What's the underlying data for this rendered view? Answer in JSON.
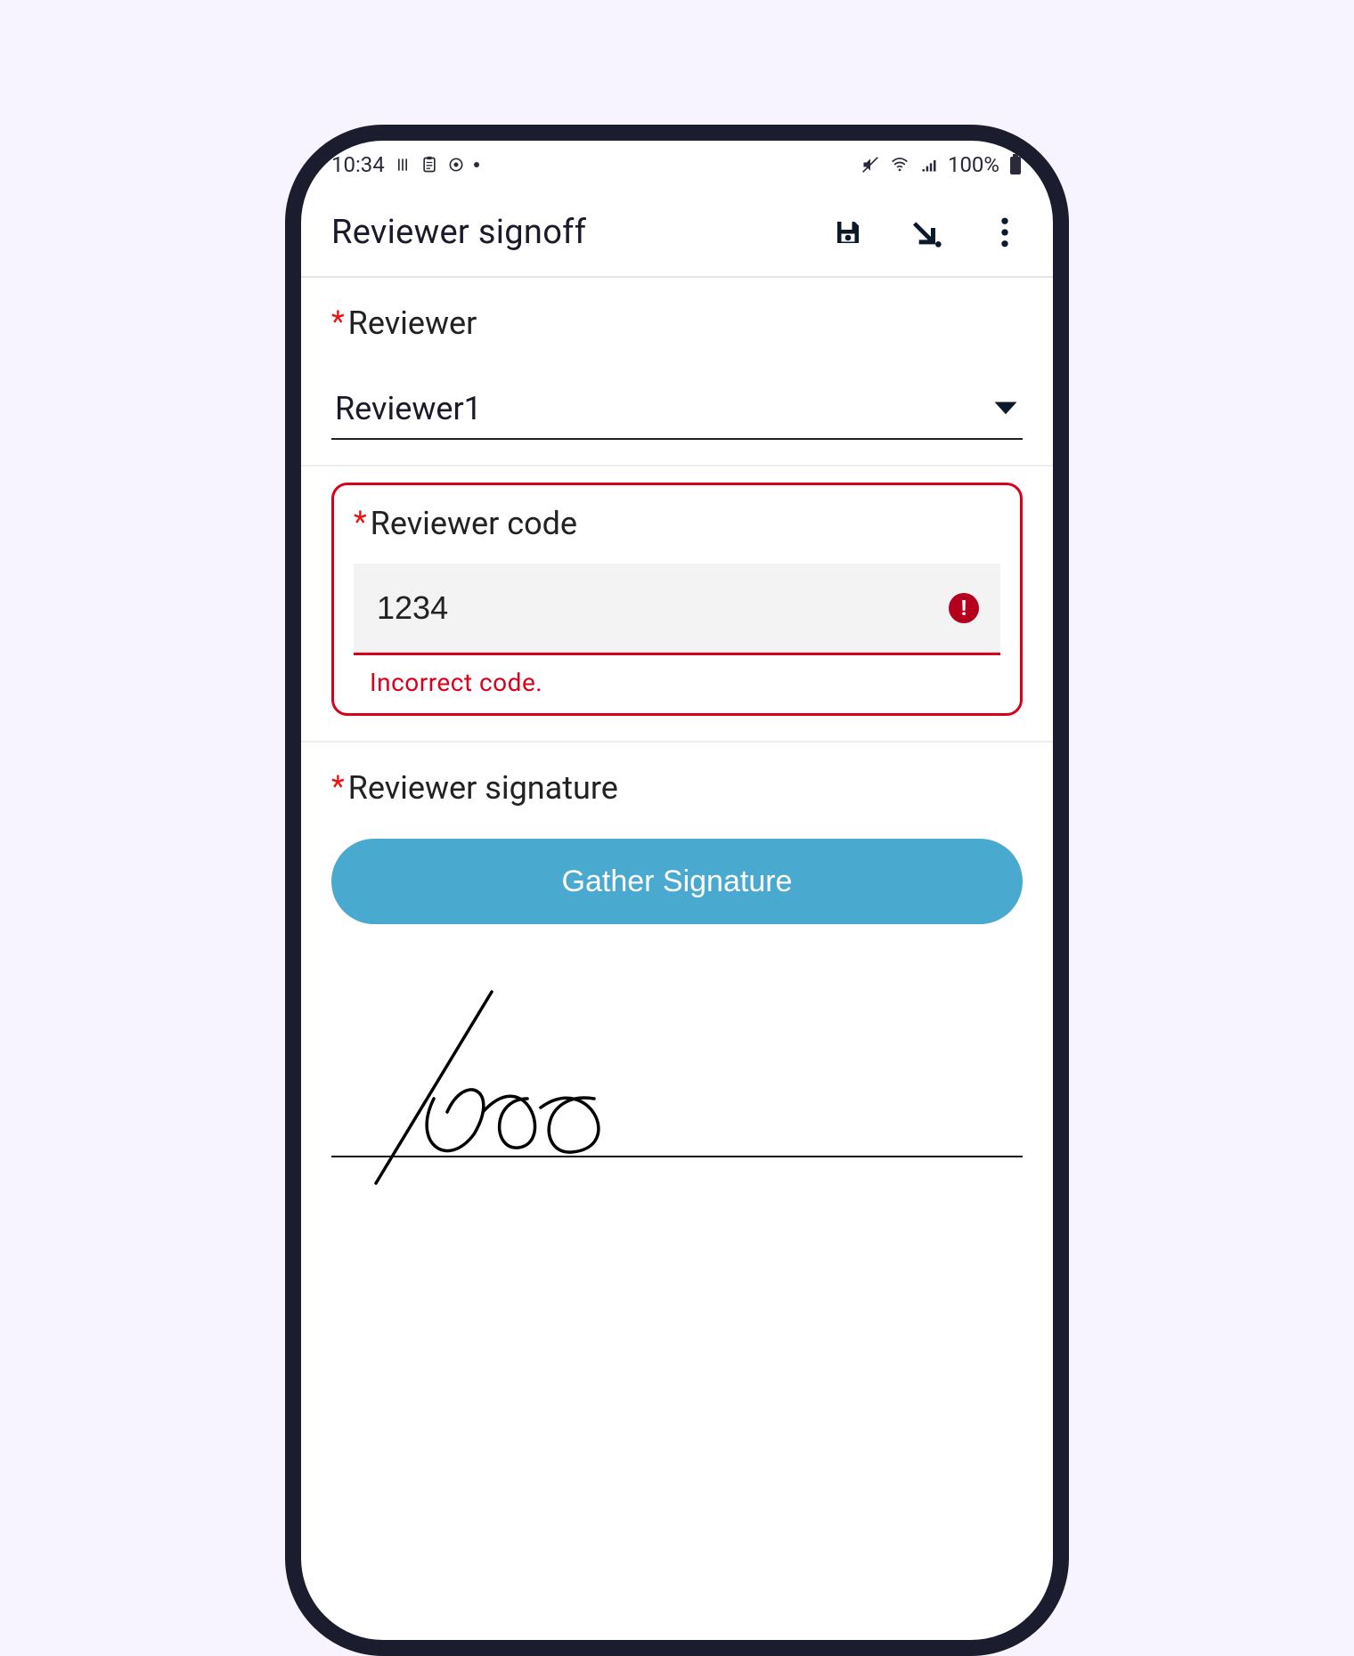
{
  "status": {
    "time": "10:34",
    "battery": "100%"
  },
  "appbar": {
    "title": "Reviewer signoff"
  },
  "reviewer": {
    "label": "Reviewer",
    "selected": "Reviewer1"
  },
  "code": {
    "label": "Reviewer code",
    "value": "1234",
    "error": "Incorrect code."
  },
  "signature": {
    "label": "Reviewer signature",
    "button": "Gather Signature"
  }
}
